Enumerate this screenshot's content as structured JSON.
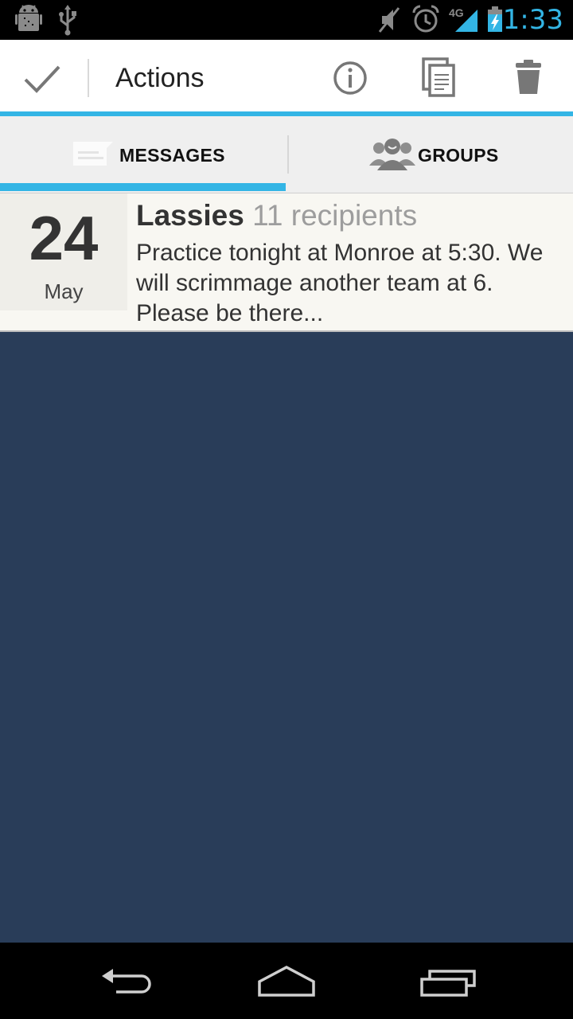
{
  "status_bar": {
    "time": "1:33",
    "network_type": "4G",
    "icons": [
      "android-debug-icon",
      "usb-icon",
      "mute-icon",
      "alarm-icon",
      "signal-icon",
      "battery-charging-icon"
    ]
  },
  "action_bar": {
    "title": "Actions",
    "icons": [
      "checkmark-icon",
      "info-icon",
      "copy-icon",
      "trash-icon"
    ]
  },
  "tabs": [
    {
      "label": "MESSAGES",
      "icon": "message-icon",
      "selected": true
    },
    {
      "label": "GROUPS",
      "icon": "groups-icon",
      "selected": false
    }
  ],
  "messages": [
    {
      "day": "24",
      "month": "May",
      "group": "Lassies",
      "recipients": "11 recipients",
      "body": "Practice tonight at Monroe at 5:30. We will scrimmage another team at 6. Please be there..."
    }
  ],
  "nav_bar": {
    "icons": [
      "back-icon",
      "home-icon",
      "recent-apps-icon"
    ]
  },
  "colors": {
    "accent": "#33b5e5",
    "background": "#293d59",
    "list_item": "#f8f7f2"
  }
}
